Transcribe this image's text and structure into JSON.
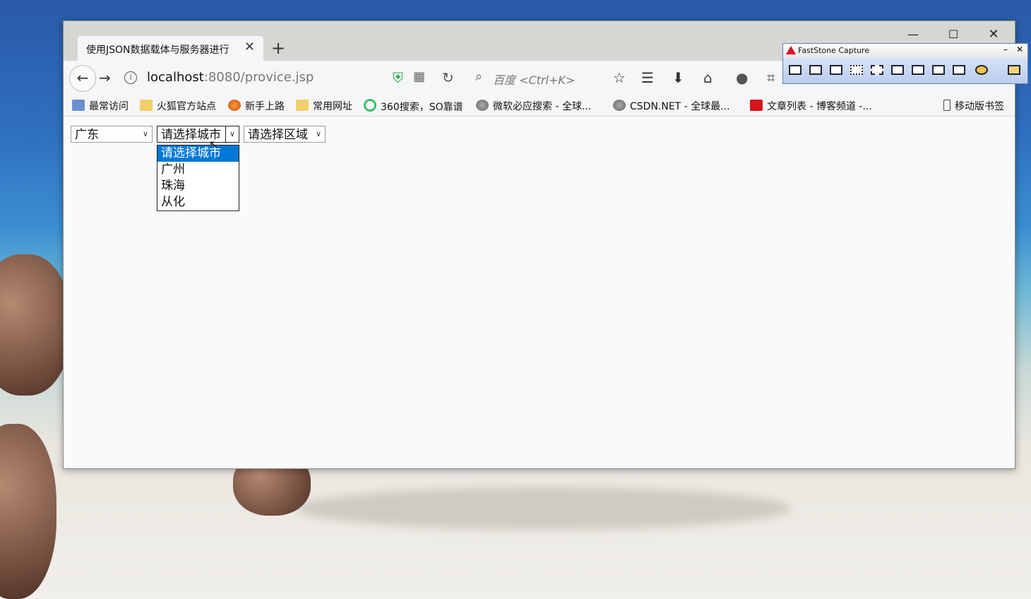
{
  "browser": {
    "tab_title": "使用JSON数据载体与服务器进行",
    "tab_close": "✕",
    "new_tab": "+",
    "window_controls": {
      "minimize": "—",
      "maximize": "☐",
      "close": "✕"
    },
    "url_host": "localhost",
    "url_rest": ":8080/provice.jsp",
    "search_placeholder": "百度 <Ctrl+K>",
    "icons": [
      "back-icon",
      "forward-icon",
      "info-icon",
      "shield-icon",
      "qr-icon",
      "reload-icon",
      "search-icon",
      "star-icon",
      "reading-list-icon",
      "download-icon",
      "home-icon",
      "chat-icon",
      "crop-icon"
    ]
  },
  "bookmarks": [
    {
      "label": "最常访问",
      "icon": "blue"
    },
    {
      "label": "火狐官方站点",
      "icon": "folder"
    },
    {
      "label": "新手上路",
      "icon": "fox"
    },
    {
      "label": "常用网址",
      "icon": "folder"
    },
    {
      "label": "360搜索，SO靠谱",
      "icon": "360"
    },
    {
      "label": "微软必应搜索 - 全球...",
      "icon": "globe"
    },
    {
      "label": "CSDN.NET - 全球最...",
      "icon": "globe"
    },
    {
      "label": "文章列表 - 博客频道 -...",
      "icon": "csdn"
    },
    {
      "label": "移动版书签",
      "icon": "phone"
    }
  ],
  "form": {
    "province_value": "广东",
    "city_value": "请选择城市",
    "area_value": "请选择区域",
    "city_options": [
      "请选择城市",
      "广州",
      "珠海",
      "从化"
    ],
    "selected_option_index": 0
  },
  "faststone": {
    "title": "FastStone Capture",
    "min": "–",
    "close": "✕",
    "accent": "#d12"
  }
}
